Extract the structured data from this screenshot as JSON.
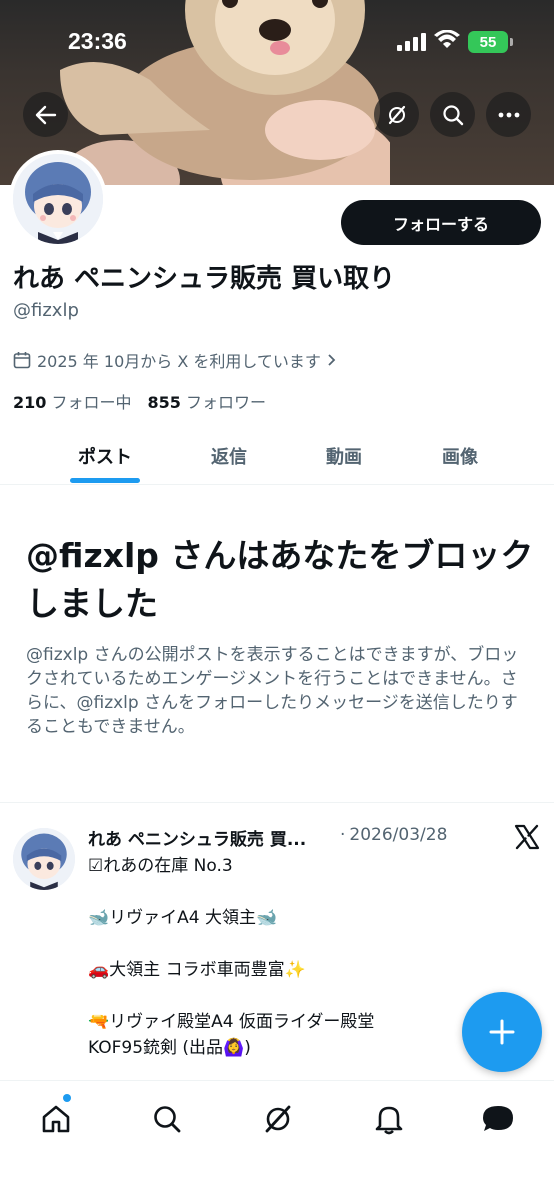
{
  "status_bar": {
    "time": "23:36",
    "battery": "55"
  },
  "profile": {
    "follow_label": "フォローする",
    "display_name": "れあ ペニンシュラ販売 買い取り",
    "handle": "@fizxlp",
    "joined": "2025 年 10月から X を利用しています",
    "following_count": "210",
    "following_label": "フォロー中",
    "followers_count": "855",
    "followers_label": "フォロワー"
  },
  "tabs": [
    {
      "label": "ポスト",
      "active": true
    },
    {
      "label": "返信",
      "active": false
    },
    {
      "label": "動画",
      "active": false
    },
    {
      "label": "画像",
      "active": false
    }
  ],
  "blocked": {
    "title": "@fizxlp さんはあなたをブロックしました",
    "body": "@fizxlp さんの公開ポストを表示することはできますが、ブロックされているためエンゲージメントを行うことはできません。さらに、@fizxlp さんをフォローしたりメッセージを送信したりすることもできません。"
  },
  "post": {
    "author": "れあ ペニンシュラ販売 買...",
    "separator": "·",
    "date": "2026/03/28",
    "lines": [
      "☑れあの在庫 No.3",
      "",
      "🐋リヴァイA4 大領主🐋",
      "",
      "🚗大領主 コラボ車両豊富✨",
      "",
      "🔫リヴァイ殿堂A4  仮面ライダー殿堂",
      "KOF95銃剣 (出品🙆‍♀️)"
    ]
  },
  "icons": {
    "back": "back-arrow-icon",
    "grok": "grok-icon",
    "search": "search-icon",
    "more": "more-icon",
    "calendar": "calendar-icon",
    "x_logo": "x-logo-icon",
    "compose": "plus-icon",
    "nav": [
      "home-icon",
      "search-icon",
      "grok-icon",
      "bell-icon",
      "messages-icon"
    ]
  },
  "colors": {
    "accent": "#1d9bf0",
    "text": "#0f1419",
    "secondary": "#536471",
    "battery": "#34c759"
  }
}
